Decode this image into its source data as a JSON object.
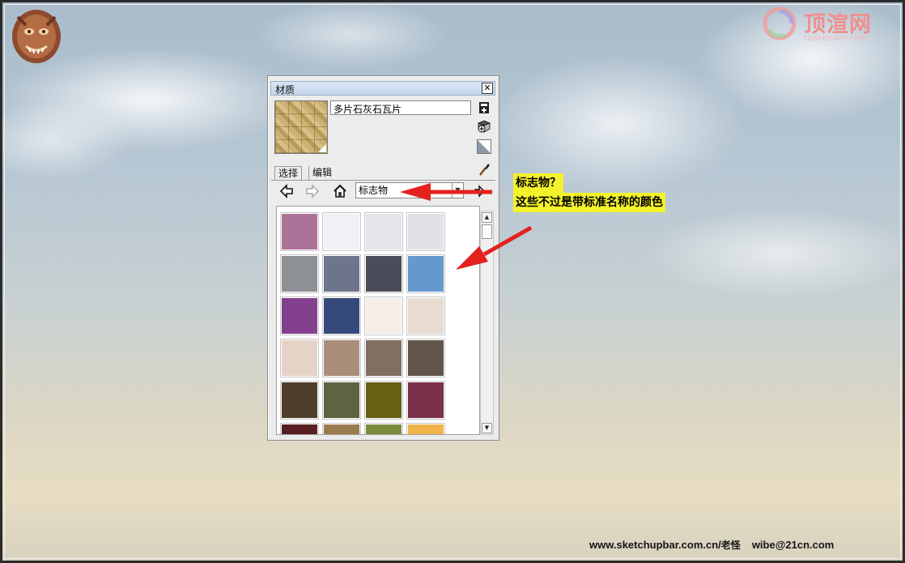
{
  "window": {
    "title": "材质",
    "close_label": "✕",
    "material_name": "多片石灰石瓦片",
    "tabs": [
      {
        "label": "选择",
        "active": true
      },
      {
        "label": "编辑",
        "active": false
      }
    ],
    "library": "标志物",
    "swatches": [
      "#ad7297",
      "#f0f1f6",
      "#e4e5e9",
      "#e1e2e6",
      "#8d9095",
      "#6e7489",
      "#4a4d59",
      "#6598cf",
      "#83408f",
      "#354a7b",
      "#f6eee7",
      "#e8dbd1",
      "#e6d3c7",
      "#aa8e7c",
      "#816f62",
      "#625549",
      "#4f3e29",
      "#5e6342",
      "#675f14",
      "#7a2f4b",
      "#5a1f21",
      "#9a7a4f",
      "#7a8b3e",
      "#efb34a"
    ]
  },
  "annotation": {
    "line1": "标志物？",
    "line2": "这些不过是带标准名称的颜色",
    "arrow_color": "#e3221e"
  },
  "watermark": {
    "text": "顶渲网",
    "url": "toprender.com"
  },
  "footer": {
    "site": "www.sketchupbar.com.cn/",
    "author": "老怪",
    "email": "wibe@21cn.com"
  }
}
